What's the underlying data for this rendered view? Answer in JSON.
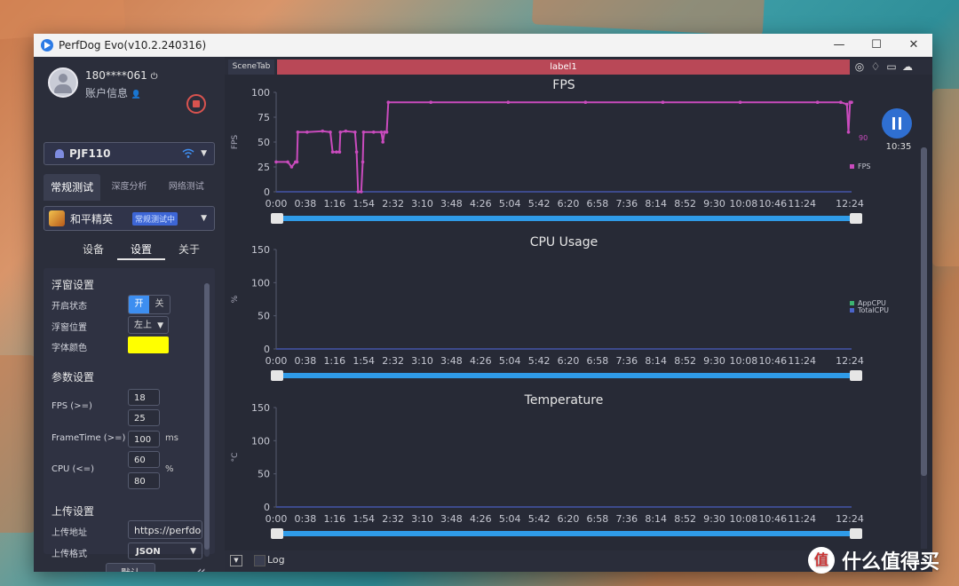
{
  "window": {
    "title": "PerfDog Evo(v10.2.240316)",
    "controls": [
      "—",
      "☐",
      "✕"
    ]
  },
  "sidebar": {
    "user": {
      "name": "180****061",
      "info": "账户信息"
    },
    "device": {
      "name": "PJF110"
    },
    "tabs": [
      "常规测试",
      "深度分析",
      "网络测试"
    ],
    "game": {
      "name": "和平精英",
      "badge": "常规测试中"
    },
    "subtabs": [
      "设备",
      "设置",
      "关于"
    ],
    "float": {
      "title": "浮窗设置",
      "state_label": "开启状态",
      "on": "开",
      "off": "关",
      "position_label": "浮窗位置",
      "position_value": "左上",
      "font_color_label": "字体颜色",
      "font_color": "#ffff00"
    },
    "params": {
      "title": "参数设置",
      "fps_label": "FPS (>=)",
      "fps_values": [
        "18",
        "25"
      ],
      "frametime_label": "FrameTime (>=)",
      "frametime_value": "100",
      "frametime_unit": "ms",
      "cpu_label": "CPU (<=)",
      "cpu_values": [
        "60",
        "80"
      ],
      "cpu_unit": "%"
    },
    "upload": {
      "title": "上传设置",
      "addr_label": "上传地址",
      "addr_value": "https://perfdog",
      "fmt_label": "上传格式",
      "fmt_value": "JSON"
    },
    "default_button": "默认"
  },
  "main": {
    "scene_tab": "SceneTab",
    "label": "label1",
    "timer": "10:35",
    "log_label": "Log"
  },
  "chart_data": [
    {
      "type": "line",
      "title": "FPS",
      "ylabel": "FPS",
      "ylim": [
        0,
        100
      ],
      "yticks": [
        "0",
        "25",
        "50",
        "75",
        "100"
      ],
      "xticks": [
        "0:00",
        "0:38",
        "1:16",
        "1:54",
        "2:32",
        "3:10",
        "3:48",
        "4:26",
        "5:04",
        "5:42",
        "6:20",
        "6:58",
        "7:36",
        "8:14",
        "8:52",
        "9:30",
        "10:08",
        "10:46",
        "11:24",
        "12:24"
      ],
      "series": [
        {
          "name": "FPS",
          "color": "#c94bbd",
          "points": [
            [
              0,
              30
            ],
            [
              15,
              30
            ],
            [
              20,
              25
            ],
            [
              25,
              30
            ],
            [
              27,
              30
            ],
            [
              28,
              60
            ],
            [
              40,
              60
            ],
            [
              60,
              61
            ],
            [
              70,
              60
            ],
            [
              73,
              40
            ],
            [
              78,
              40
            ],
            [
              82,
              40
            ],
            [
              83,
              60
            ],
            [
              90,
              61
            ],
            [
              102,
              60
            ],
            [
              104,
              40
            ],
            [
              106,
              0
            ],
            [
              110,
              0
            ],
            [
              112,
              30
            ],
            [
              113,
              60
            ],
            [
              126,
              60
            ],
            [
              136,
              60
            ],
            [
              138,
              50
            ],
            [
              140,
              60
            ],
            [
              143,
              60
            ],
            [
              145,
              90
            ],
            [
              200,
              90
            ],
            [
              300,
              90
            ],
            [
              400,
              90
            ],
            [
              500,
              90
            ],
            [
              600,
              90
            ],
            [
              700,
              90
            ],
            [
              730,
              90
            ],
            [
              738,
              88
            ],
            [
              740,
              60
            ],
            [
              742,
              90
            ],
            [
              744,
              90
            ]
          ]
        }
      ],
      "last_value": "90"
    },
    {
      "type": "line",
      "title": "CPU Usage",
      "ylabel": "%",
      "ylim": [
        0,
        150
      ],
      "yticks": [
        "0",
        "50",
        "100",
        "150"
      ],
      "xticks": [
        "0:00",
        "0:38",
        "1:16",
        "1:54",
        "2:32",
        "3:10",
        "3:48",
        "4:26",
        "5:04",
        "5:42",
        "6:20",
        "6:58",
        "7:36",
        "8:14",
        "8:52",
        "9:30",
        "10:08",
        "10:46",
        "11:24",
        "12:24"
      ],
      "series": [
        {
          "name": "AppCPU",
          "color": "#3cb371"
        },
        {
          "name": "TotalCPU",
          "color": "#4a63c9"
        }
      ]
    },
    {
      "type": "line",
      "title": "Temperature",
      "ylabel": "°C",
      "ylim": [
        0,
        150
      ],
      "yticks": [
        "0",
        "50",
        "100",
        "150"
      ],
      "xticks": [
        "0:00",
        "0:38",
        "1:16",
        "1:54",
        "2:32",
        "3:10",
        "3:48",
        "4:26",
        "5:04",
        "5:42",
        "6:20",
        "6:58",
        "7:36",
        "8:14",
        "8:52",
        "9:30",
        "10:08",
        "10:46",
        "11:24",
        "12:24"
      ],
      "series": []
    }
  ],
  "watermark": {
    "logo": "值",
    "text": "什么值得买"
  }
}
